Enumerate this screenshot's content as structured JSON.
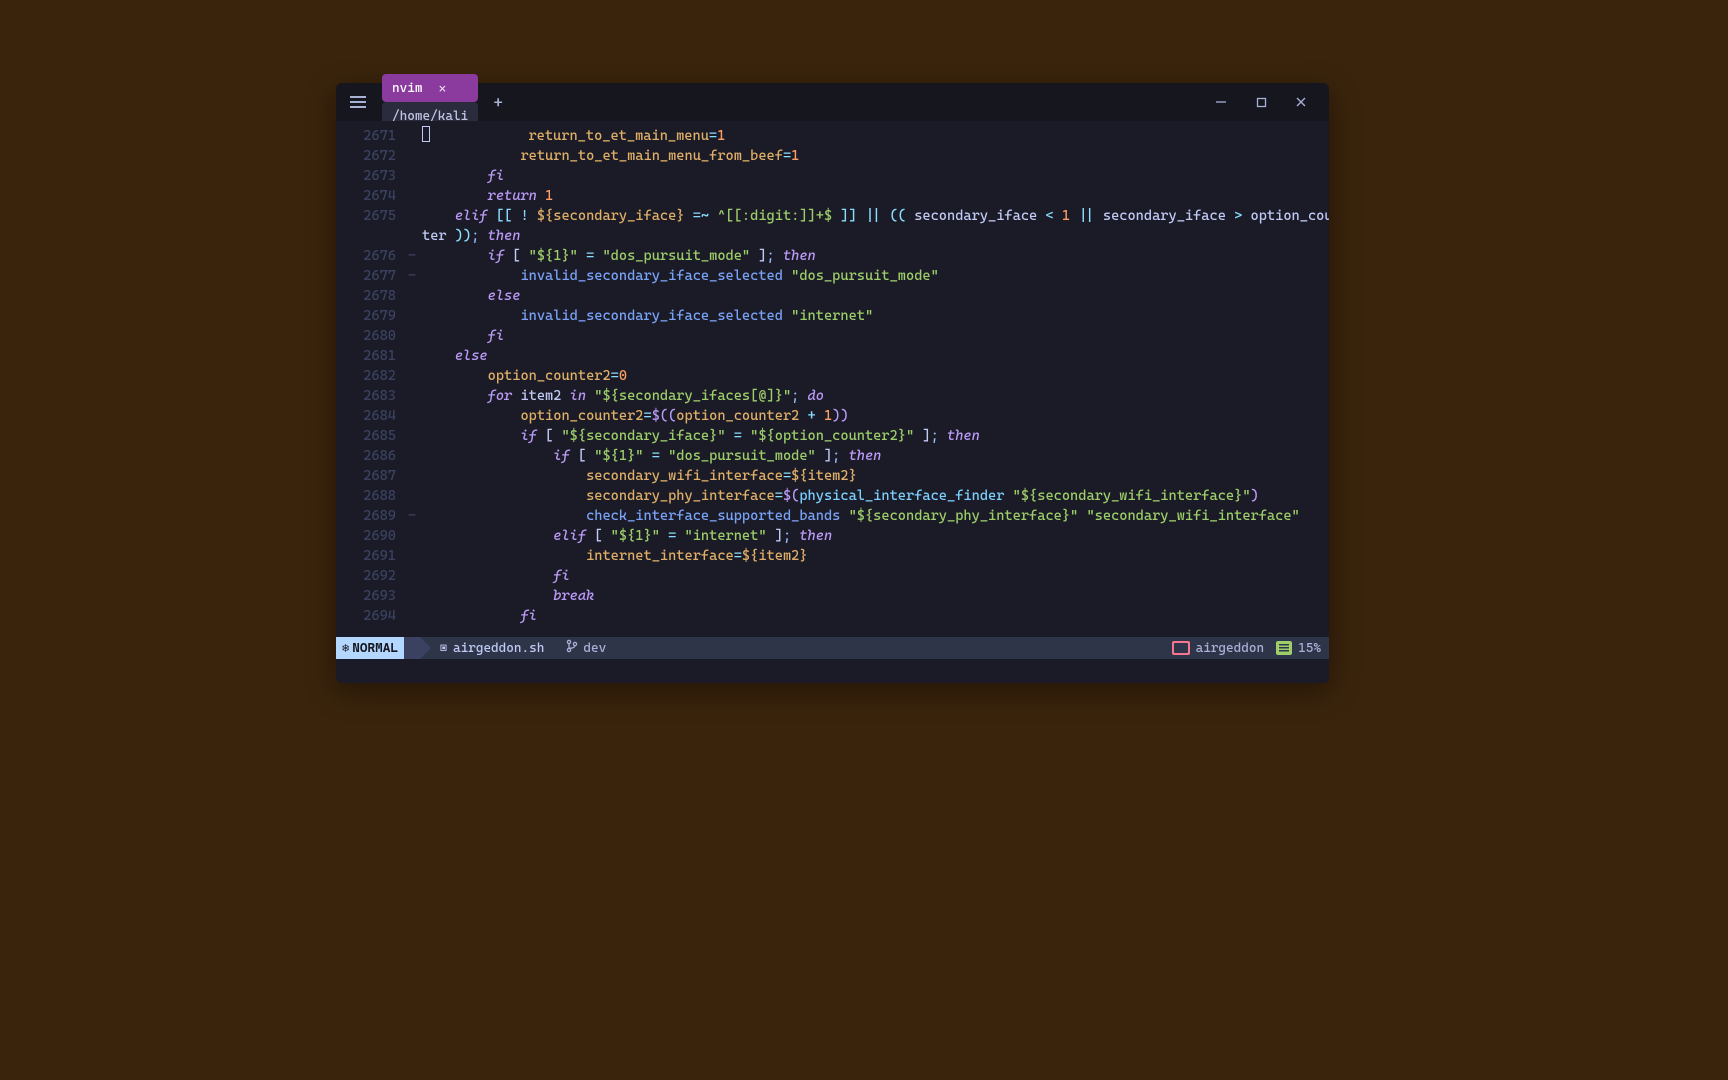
{
  "window": {
    "tabs": [
      {
        "label": "nvim",
        "active": true
      },
      {
        "label": "/home/kali",
        "active": false
      }
    ]
  },
  "status": {
    "mode": "NORMAL",
    "filename": "airgeddon.sh",
    "branch": "dev",
    "project": "airgeddon",
    "percent": "15%"
  },
  "code": {
    "first_line": 2671,
    "lines": [
      [
        [
          "p",
          "            "
        ],
        [
          "var",
          "return_to_et_main_menu"
        ],
        [
          "op",
          "="
        ],
        [
          "num",
          "1"
        ]
      ],
      [
        [
          "p",
          "            "
        ],
        [
          "var",
          "return_to_et_main_menu_from_beef"
        ],
        [
          "op",
          "="
        ],
        [
          "num",
          "1"
        ]
      ],
      [
        [
          "p",
          "        "
        ],
        [
          "kw",
          "fi"
        ]
      ],
      [
        [
          "p",
          "        "
        ],
        [
          "kw",
          "return"
        ],
        [
          "p",
          " "
        ],
        [
          "num",
          "1"
        ]
      ],
      [
        [
          "p",
          "    "
        ],
        [
          "kw",
          "elif"
        ],
        [
          "p",
          " "
        ],
        [
          "op",
          "[["
        ],
        [
          "p",
          " "
        ],
        [
          "op",
          "!"
        ],
        [
          "p",
          " "
        ],
        [
          "var",
          "${secondary_iface}"
        ],
        [
          "p",
          " "
        ],
        [
          "op",
          "=~"
        ],
        [
          "p",
          " "
        ],
        [
          "str",
          "^[[:digit:]]+$"
        ],
        [
          "p",
          " "
        ],
        [
          "op",
          "]]"
        ],
        [
          "p",
          " "
        ],
        [
          "op",
          "||"
        ],
        [
          "p",
          " "
        ],
        [
          "op",
          "(("
        ],
        [
          "p",
          " "
        ],
        [
          "var2",
          "secondary_iface"
        ],
        [
          "p",
          " "
        ],
        [
          "op",
          "<"
        ],
        [
          "p",
          " "
        ],
        [
          "num",
          "1"
        ],
        [
          "p",
          " "
        ],
        [
          "op",
          "||"
        ],
        [
          "p",
          " "
        ],
        [
          "var2",
          "secondary_iface"
        ],
        [
          "p",
          " "
        ],
        [
          "op",
          ">"
        ],
        [
          "p",
          " "
        ],
        [
          "var2",
          "option_coun"
        ]
      ],
      [
        [
          "p",
          "ter "
        ],
        [
          "op",
          "))"
        ],
        [
          "punc",
          ";"
        ],
        [
          "p",
          " "
        ],
        [
          "kw",
          "then"
        ]
      ],
      [
        [
          "p",
          "        "
        ],
        [
          "kw",
          "if"
        ],
        [
          "p",
          " [ "
        ],
        [
          "str",
          "\"${1}\""
        ],
        [
          "p",
          " "
        ],
        [
          "op",
          "="
        ],
        [
          "p",
          " "
        ],
        [
          "str",
          "\"dos_pursuit_mode\""
        ],
        [
          "p",
          " ]"
        ],
        [
          "punc",
          ";"
        ],
        [
          "p",
          " "
        ],
        [
          "kw",
          "then"
        ]
      ],
      [
        [
          "p",
          "            "
        ],
        [
          "fn",
          "invalid_secondary_iface_selected"
        ],
        [
          "p",
          " "
        ],
        [
          "str",
          "\"dos_pursuit_mode\""
        ]
      ],
      [
        [
          "p",
          "        "
        ],
        [
          "kw",
          "else"
        ]
      ],
      [
        [
          "p",
          "            "
        ],
        [
          "fn",
          "invalid_secondary_iface_selected"
        ],
        [
          "p",
          " "
        ],
        [
          "str",
          "\"internet\""
        ]
      ],
      [
        [
          "p",
          "        "
        ],
        [
          "kw",
          "fi"
        ]
      ],
      [
        [
          "p",
          "    "
        ],
        [
          "kw",
          "else"
        ]
      ],
      [
        [
          "p",
          "        "
        ],
        [
          "var",
          "option_counter2"
        ],
        [
          "op",
          "="
        ],
        [
          "num",
          "0"
        ]
      ],
      [
        [
          "p",
          "        "
        ],
        [
          "kw",
          "for"
        ],
        [
          "p",
          " "
        ],
        [
          "var2",
          "item2"
        ],
        [
          "p",
          " "
        ],
        [
          "kw",
          "in"
        ],
        [
          "p",
          " "
        ],
        [
          "str",
          "\"${secondary_ifaces[@]}\""
        ],
        [
          "punc",
          ";"
        ],
        [
          "p",
          " "
        ],
        [
          "kw",
          "do"
        ]
      ],
      [
        [
          "p",
          "            "
        ],
        [
          "var",
          "option_counter2"
        ],
        [
          "op",
          "="
        ],
        [
          "paren",
          "$(("
        ],
        [
          "var",
          "option_counter2"
        ],
        [
          "p",
          " "
        ],
        [
          "op",
          "+"
        ],
        [
          "p",
          " "
        ],
        [
          "num",
          "1"
        ],
        [
          "paren",
          "))"
        ]
      ],
      [
        [
          "p",
          "            "
        ],
        [
          "kw",
          "if"
        ],
        [
          "p",
          " [ "
        ],
        [
          "str",
          "\"${secondary_iface}\""
        ],
        [
          "p",
          " "
        ],
        [
          "op",
          "="
        ],
        [
          "p",
          " "
        ],
        [
          "str",
          "\"${option_counter2}\""
        ],
        [
          "p",
          " ]"
        ],
        [
          "punc",
          ";"
        ],
        [
          "p",
          " "
        ],
        [
          "kw",
          "then"
        ]
      ],
      [
        [
          "p",
          "                "
        ],
        [
          "kw",
          "if"
        ],
        [
          "p",
          " [ "
        ],
        [
          "str",
          "\"${1}\""
        ],
        [
          "p",
          " "
        ],
        [
          "op",
          "="
        ],
        [
          "p",
          " "
        ],
        [
          "str",
          "\"dos_pursuit_mode\""
        ],
        [
          "p",
          " ]"
        ],
        [
          "punc",
          ";"
        ],
        [
          "p",
          " "
        ],
        [
          "kw",
          "then"
        ]
      ],
      [
        [
          "p",
          "                    "
        ],
        [
          "var",
          "secondary_wifi_interface"
        ],
        [
          "op",
          "="
        ],
        [
          "var",
          "${item2}"
        ]
      ],
      [
        [
          "p",
          "                    "
        ],
        [
          "var",
          "secondary_phy_interface"
        ],
        [
          "op",
          "="
        ],
        [
          "paren",
          "$("
        ],
        [
          "fn2",
          "physical_interface_finder"
        ],
        [
          "p",
          " "
        ],
        [
          "str",
          "\"${secondary_wifi_interface}\""
        ],
        [
          "paren",
          ")"
        ]
      ],
      [
        [
          "p",
          "                    "
        ],
        [
          "fn",
          "check_interface_supported_bands"
        ],
        [
          "p",
          " "
        ],
        [
          "str",
          "\"${secondary_phy_interface}\""
        ],
        [
          "p",
          " "
        ],
        [
          "str",
          "\"secondary_wifi_interface\""
        ]
      ],
      [
        [
          "p",
          "                "
        ],
        [
          "kw",
          "elif"
        ],
        [
          "p",
          " [ "
        ],
        [
          "str",
          "\"${1}\""
        ],
        [
          "p",
          " "
        ],
        [
          "op",
          "="
        ],
        [
          "p",
          " "
        ],
        [
          "str",
          "\"internet\""
        ],
        [
          "p",
          " ]"
        ],
        [
          "punc",
          ";"
        ],
        [
          "p",
          " "
        ],
        [
          "kw",
          "then"
        ]
      ],
      [
        [
          "p",
          "                    "
        ],
        [
          "var",
          "internet_interface"
        ],
        [
          "op",
          "="
        ],
        [
          "var",
          "${item2}"
        ]
      ],
      [
        [
          "p",
          "                "
        ],
        [
          "kw",
          "fi"
        ]
      ],
      [
        [
          "p",
          "                "
        ],
        [
          "kw",
          "break"
        ]
      ],
      [
        [
          "p",
          "            "
        ],
        [
          "kw",
          "fi"
        ]
      ]
    ],
    "wrap_line_index": 5,
    "signs": {
      "6": "-",
      "7": "-",
      "19": "-"
    },
    "cursor_line_index": 0
  }
}
